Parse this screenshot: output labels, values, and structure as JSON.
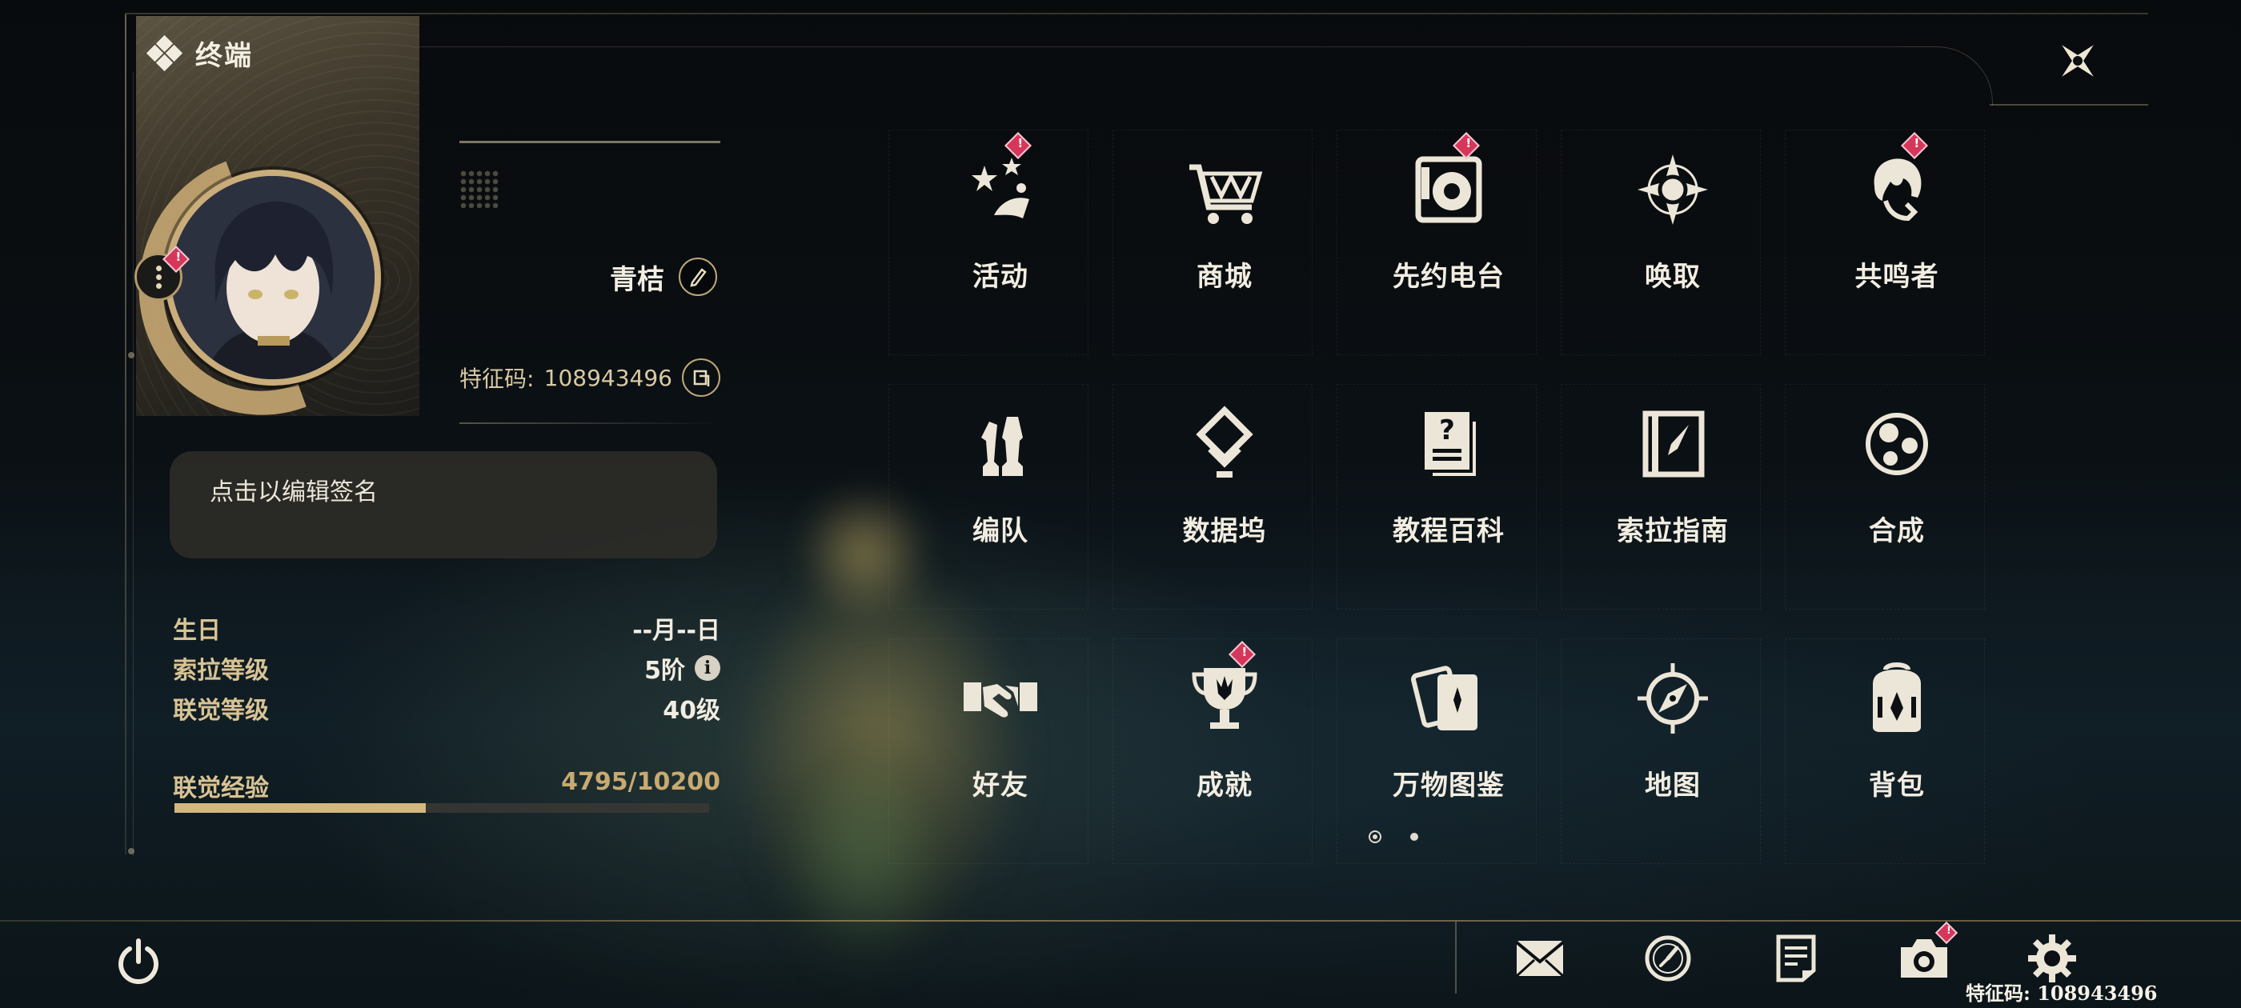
{
  "header": {
    "title": "终端"
  },
  "profile": {
    "name": "青桔",
    "uid_label": "特征码:",
    "uid_value": "108943496",
    "signature_placeholder": "点击以编辑签名",
    "stats": [
      {
        "label": "生日",
        "value": "--月--日"
      },
      {
        "label": "索拉等级",
        "value": "5阶"
      },
      {
        "label": "联觉等级",
        "value": "40级"
      }
    ],
    "exp": {
      "label": "联觉经验",
      "value": "4795/10200",
      "current": 4795,
      "max": 10200
    }
  },
  "menu": [
    {
      "label": "活动",
      "icon": "activity-icon",
      "badge": true
    },
    {
      "label": "商城",
      "icon": "shop-cart-icon",
      "badge": false
    },
    {
      "label": "先约电台",
      "icon": "radio-icon",
      "badge": true
    },
    {
      "label": "唤取",
      "icon": "convene-icon",
      "badge": false
    },
    {
      "label": "共鸣者",
      "icon": "resonator-icon",
      "badge": true
    },
    {
      "label": "编队",
      "icon": "team-chess-icon",
      "badge": false
    },
    {
      "label": "数据坞",
      "icon": "data-bank-icon",
      "badge": false
    },
    {
      "label": "教程百科",
      "icon": "tutorial-icon",
      "badge": false
    },
    {
      "label": "索拉指南",
      "icon": "guidebook-icon",
      "badge": false
    },
    {
      "label": "合成",
      "icon": "synthesis-icon",
      "badge": false
    },
    {
      "label": "好友",
      "icon": "handshake-icon",
      "badge": false
    },
    {
      "label": "成就",
      "icon": "trophy-icon",
      "badge": true
    },
    {
      "label": "万物图鉴",
      "icon": "archive-cards-icon",
      "badge": false
    },
    {
      "label": "地图",
      "icon": "compass-icon",
      "badge": false
    },
    {
      "label": "背包",
      "icon": "backpack-icon",
      "badge": false
    }
  ],
  "pagination": {
    "current": 1,
    "total": 2
  },
  "bottom_bar": {
    "tools": [
      {
        "icon": "mail-icon",
        "badge": false
      },
      {
        "icon": "clock-icon",
        "badge": false
      },
      {
        "icon": "notice-icon",
        "badge": false
      },
      {
        "icon": "camera-icon",
        "badge": true
      },
      {
        "icon": "settings-gear-icon",
        "badge": false
      }
    ],
    "uid_footer": "特征码: 108943496"
  },
  "colors": {
    "accent_gold": "#c9ad7a",
    "badge_red": "#d6365a",
    "text": "#f2ede1"
  }
}
